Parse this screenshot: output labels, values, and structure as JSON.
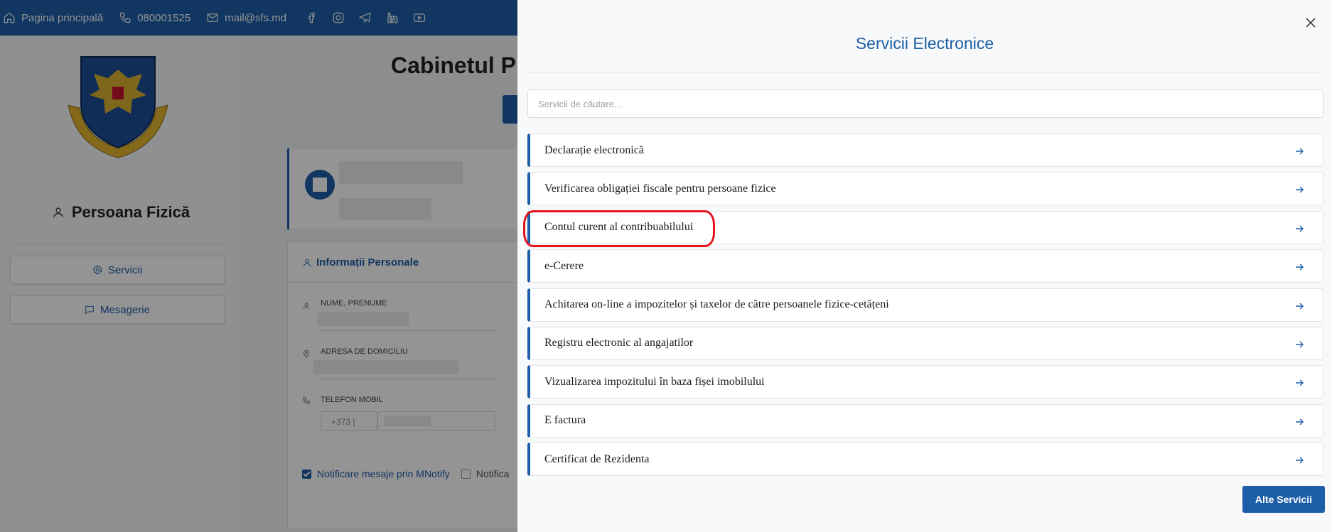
{
  "topbar": {
    "home_label": "Pagina principală",
    "phone": "080001525",
    "email": "mail@sfs.md",
    "social_icons": [
      "facebook-icon",
      "instagram-icon",
      "telegram-icon",
      "linkedin-icon",
      "youtube-icon"
    ]
  },
  "sidebar": {
    "title": "Persoana Fizică",
    "buttons": [
      {
        "label": "Servicii",
        "icon": "gear-icon"
      },
      {
        "label": "Mesagerie",
        "icon": "chat-icon"
      }
    ]
  },
  "main": {
    "title": "Cabinetul P",
    "info": {
      "title": "Informații Personale",
      "fields": [
        {
          "label": "NUME, PRENUME"
        },
        {
          "label": "ADRESA DE DOMICILIU"
        },
        {
          "label": "TELEFON MOBIL"
        }
      ],
      "phone_prefix": "+373 |",
      "notif_mnotify": "Notificare mesaje prin MNotify",
      "notif_other": "Notifica"
    }
  },
  "modal": {
    "title": "Servicii Electronice",
    "search_placeholder": "Servicii de căutare...",
    "services": [
      {
        "label": "Declarație electronică"
      },
      {
        "label": "Verificarea obligației fiscale pentru persoane fizice"
      },
      {
        "label": "Contul curent al contribuabilului"
      },
      {
        "label": "e-Cerere"
      },
      {
        "label": "Achitarea on-line a impozitelor și taxelor de către persoanele fizice-cetățeni"
      },
      {
        "label": "Registru electronic al angajatilor"
      },
      {
        "label": "Vizualizarea impozitului în baza fișei imobilului"
      },
      {
        "label": "E factura"
      },
      {
        "label": "Certificat de Rezidenta"
      }
    ],
    "more_button": "Alte Servicii"
  },
  "colors": {
    "brand_blue": "#1d5ea8",
    "highlight_red": "#e3141c"
  }
}
